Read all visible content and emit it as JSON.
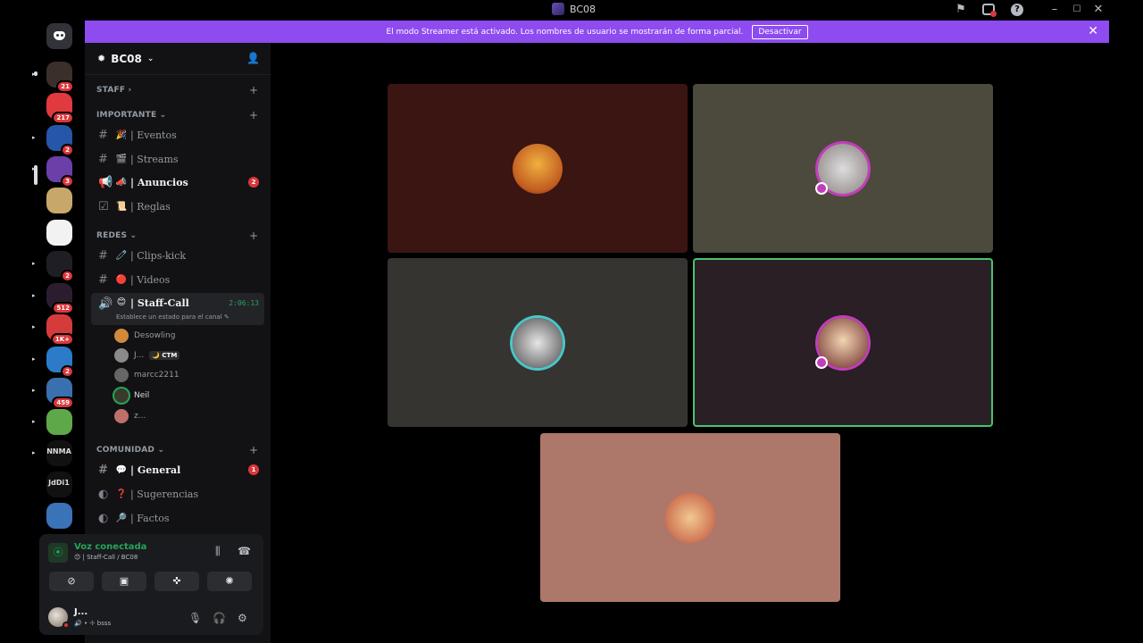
{
  "window": {
    "title": "BC08",
    "icons": [
      "flag-icon",
      "inbox-icon",
      "help-icon",
      "minimize-icon",
      "maximize-icon",
      "close-icon"
    ]
  },
  "banner": {
    "text": "El modo Streamer está activado. Los nombres de usuario se mostrarán de forma parcial.",
    "button": "Desactivar",
    "close": "✕"
  },
  "servers": [
    {
      "badge": "21",
      "color": "#3b2f2c"
    },
    {
      "badge": "217",
      "color": "#e0393e"
    },
    {
      "badge": "2",
      "color": "#2556a8"
    },
    {
      "badge": "3",
      "color": "#6a3fa8"
    },
    {
      "badge": "",
      "color": "#c8a86a"
    },
    {
      "badge": "",
      "color": "#f2f2f2"
    },
    {
      "badge": "2",
      "color": "#1e1e24"
    },
    {
      "badge": "512",
      "color": "#2a1e2e"
    },
    {
      "badge": "1K+",
      "color": "#d63b3b"
    },
    {
      "badge": "2",
      "color": "#2c7bc8"
    },
    {
      "badge": "459",
      "color": "#3a6fb0"
    },
    {
      "badge": "",
      "color": "#5ea84a"
    },
    {
      "badge": "",
      "color": "#111",
      "tag": "NNMA"
    },
    {
      "badge": "",
      "color": "#111",
      "tag": "JdDi1"
    },
    {
      "badge": "",
      "color": "#3a73b8"
    }
  ],
  "sidebar": {
    "server_name": "BC08",
    "categories": {
      "staff": "STAFF",
      "importante": "IMPORTANTE",
      "redes": "REDES",
      "comunidad": "COMUNIDAD"
    },
    "channels": {
      "eventos": "| Eventos",
      "streams": "| Streams",
      "anuncios": "| Anuncios",
      "anuncios_badge": "2",
      "reglas": "| Reglas",
      "clips": "| Clips-kick",
      "videos": "| Videos",
      "staffcall": "| Staff-Call",
      "staffcall_timer": "2:06:13",
      "staffcall_status": "Establece un estado para el canal",
      "general": "| General",
      "general_badge": "1",
      "sugerencias": "| Sugerencias",
      "factos": "| Factos"
    },
    "voice_users": [
      {
        "name": "Desowling",
        "tag": ""
      },
      {
        "name": "J...",
        "tag": "CTM"
      },
      {
        "name": "marcc2211",
        "tag": ""
      },
      {
        "name": "Neil",
        "tag": ""
      },
      {
        "name": "z...",
        "tag": ""
      }
    ]
  },
  "voice_panel": {
    "title": "Voz conectada",
    "subtitle": "😊 | Staff-Call / BC08"
  },
  "user": {
    "name": "J...",
    "status": "bsss"
  },
  "tiles": [
    {
      "color": "#3a1511"
    },
    {
      "color": "#4b4a3c"
    },
    {
      "color": "#353431"
    },
    {
      "color": "#2a1f24"
    },
    {
      "color": "#ad7769"
    }
  ]
}
